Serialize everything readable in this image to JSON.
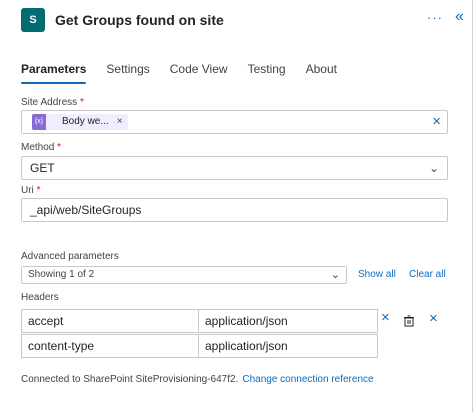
{
  "header": {
    "app_icon_text": "S",
    "title": "Get Groups found on site",
    "more_label": "···",
    "collapse_label": "«"
  },
  "tabs": [
    {
      "label": "Parameters",
      "active": true
    },
    {
      "label": "Settings",
      "active": false
    },
    {
      "label": "Code View",
      "active": false
    },
    {
      "label": "Testing",
      "active": false
    },
    {
      "label": "About",
      "active": false
    }
  ],
  "site_address": {
    "label": "Site Address",
    "required": "*",
    "token_icon": "{x}",
    "token_label": "Body we...",
    "token_remove": "×",
    "clear": "×"
  },
  "method": {
    "label": "Method",
    "required": "*",
    "value": "GET",
    "chevron": "⌄"
  },
  "uri": {
    "label": "Uri",
    "required": "*",
    "value": "_api/web/SiteGroups"
  },
  "advanced": {
    "label": "Advanced parameters",
    "value": "Showing 1 of 2",
    "chevron": "⌄",
    "show_all": "Show all",
    "clear_all": "Clear all"
  },
  "headers": {
    "label": "Headers",
    "rows": [
      {
        "key": "accept",
        "value": "application/json"
      },
      {
        "key": "content-type",
        "value": "application/json"
      }
    ],
    "remove": "×"
  },
  "footer": {
    "text": "Connected to SharePoint SiteProvisioning-647f2.",
    "link": "Change connection reference"
  },
  "colors": {
    "accent": "#0f6cbd",
    "sharepoint": "#036c70",
    "token": "#8c6ad6"
  }
}
